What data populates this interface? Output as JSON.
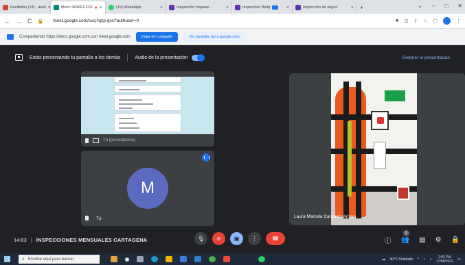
{
  "browser": {
    "tabs": [
      {
        "title": "Recibidos (18) - auxil",
        "color": "#db4437",
        "active": false
      },
      {
        "title": "Meet: INSPECCIO",
        "color": "#00897b",
        "active": true
      },
      {
        "title": "(19) WhatsApp",
        "color": "#25d366",
        "active": false
      },
      {
        "title": "Inspección Impiaaz...",
        "color": "#5e35b1",
        "active": false
      },
      {
        "title": "Inspección Botiq",
        "color": "#5e35b1",
        "active": false
      },
      {
        "title": "Inspección de seguri",
        "color": "#5e35b1",
        "active": false
      }
    ],
    "new_tab": "+",
    "window_controls": [
      "⌄",
      "–",
      "□",
      "✕"
    ],
    "url": "meet.google.com/suq-fqzp-gsc?authuser=0"
  },
  "share_bar": {
    "text": "Compartiendo https://docs.google.com con meet.google.com",
    "stop_button": "Dejar de compartir",
    "switch_button": "Ver pantalla: docs.google.com"
  },
  "presenting_bar": {
    "text": "Estás presentando tu pantalla a los demás",
    "audio_label": "Audio de la presentación",
    "stop_label": "Detener la presentación"
  },
  "tiles": {
    "doc_name": "Tú (presentación)",
    "self_initial": "M",
    "self_name": "Tú",
    "laura_name": "Laura Marcela Carabalo Arroyo"
  },
  "bottom_bar": {
    "time": "14:03",
    "separator": "|",
    "meeting_name": "INSPECCIONES MENSUALES CARTAGENA",
    "participants_badge": "3",
    "controls": {
      "mic": "🎙",
      "camera": "⊘",
      "present": "▣",
      "more": "⋮",
      "hangup": "☎"
    },
    "right_icons": {
      "info": "ⓘ",
      "people": "👥",
      "chat": "▤",
      "activities": "⚙",
      "lock": "🔒"
    }
  },
  "taskbar": {
    "search_icon": "⌕",
    "search_placeholder": "Escribe aquí para buscar",
    "weather": "30°C Nublado",
    "time": "2:03 PM",
    "date": "17/08/2022"
  },
  "colors": {
    "meet_bg": "#202124",
    "accent": "#1a73e8",
    "hangup": "#ea4335"
  }
}
